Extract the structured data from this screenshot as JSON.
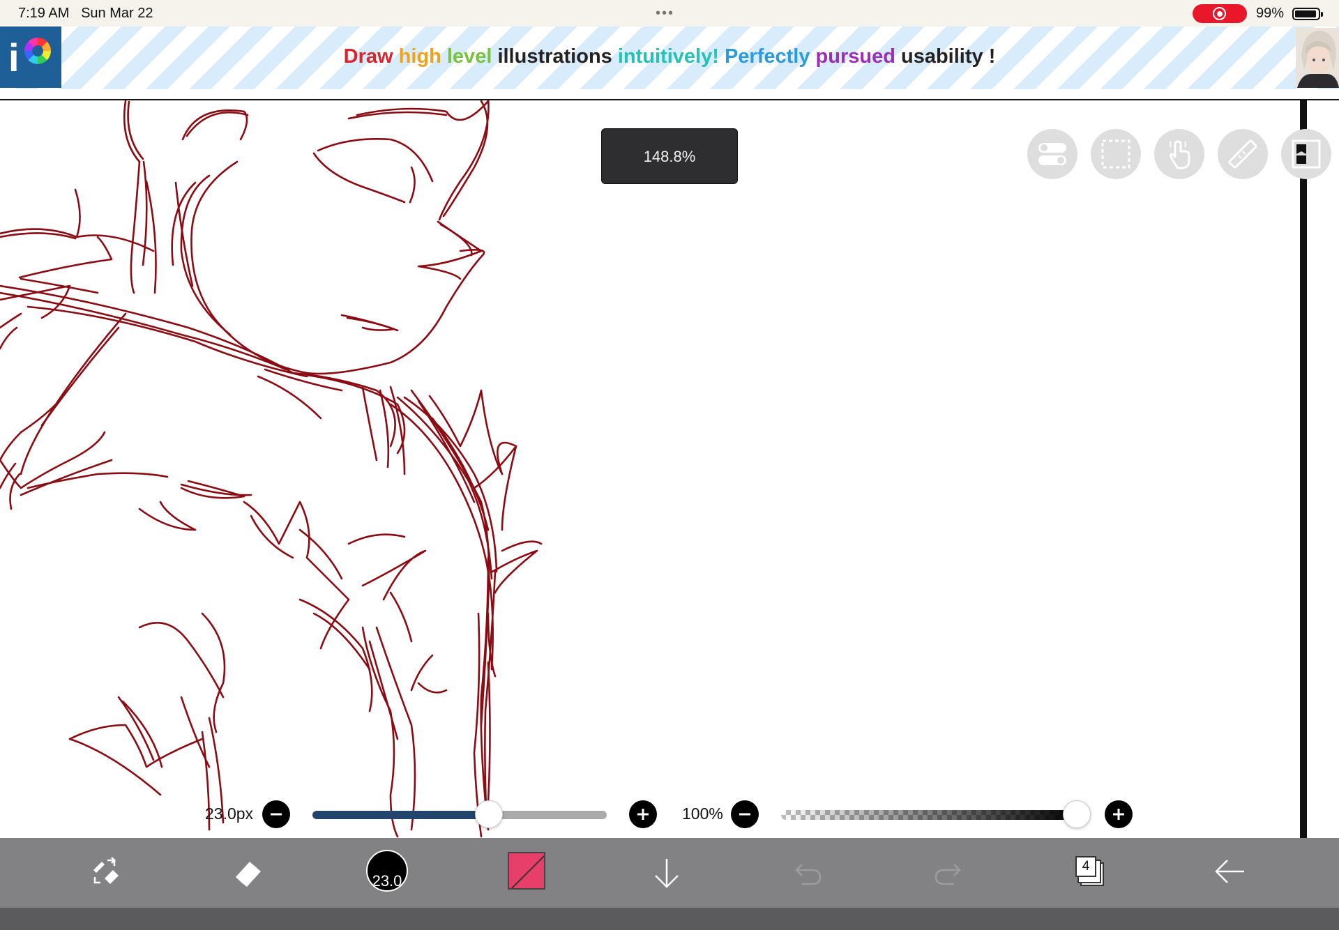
{
  "status_bar": {
    "time": "7:19 AM",
    "date": "Sun Mar 22",
    "multitask_dots": "•••",
    "battery_percent": "99%"
  },
  "ad_banner": {
    "words": [
      {
        "text": "Draw ",
        "color": "#d9262e"
      },
      {
        "text": "high ",
        "color": "#f0a21c"
      },
      {
        "text": "level ",
        "color": "#7ac13f"
      },
      {
        "text": "illustrations ",
        "color": "#222222"
      },
      {
        "text": "intuitively! ",
        "color": "#25c1b6"
      },
      {
        "text": "Perfectly ",
        "color": "#2b9be0"
      },
      {
        "text": "pursued ",
        "color": "#9b2fb5"
      },
      {
        "text": "usability",
        "color": "#222222"
      },
      {
        "text": " !",
        "color": "#222222"
      }
    ],
    "logo_letter": "i"
  },
  "canvas": {
    "zoom_level": "148.8%",
    "stroke_color": "#8c0b12"
  },
  "brush_controls": {
    "size_label": "23.0px",
    "size_fraction": 0.6,
    "opacity_label": "100%",
    "opacity_fraction": 1.0
  },
  "toolbar": {
    "brush_size_value": "23.0",
    "current_color": "#e83e6a",
    "layer_count": "4"
  },
  "tools_right": [
    "toggle-icon",
    "selection-icon",
    "touch-hand-icon",
    "ruler-icon",
    "layer-material-icon"
  ],
  "tools_bottom": [
    "transform-tool-icon",
    "eraser-icon",
    "brush-size-icon",
    "color-icon",
    "move-down-icon",
    "undo-icon",
    "redo-icon",
    "layers-icon",
    "back-arrow-icon"
  ]
}
